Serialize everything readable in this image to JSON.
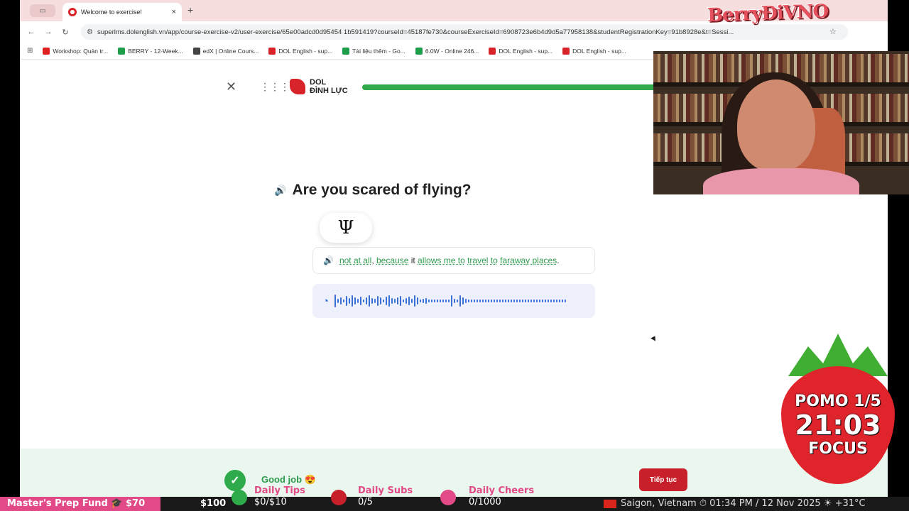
{
  "browser": {
    "tab_title": "Welcome to exercise!",
    "tab_close": "×",
    "new_tab": "+",
    "url": "superlms.dolenglish.vn/app/course-exercise-v2/user-exercise/65e00adcd0d95454 1b591419?courseId=45187fe730&courseExerciseId=6908723e6b4d9d5a77958138&studentRegistrationKey=91b8928e&t=Sessi...",
    "bookmarks": [
      {
        "label": "Workshop: Quản tr...",
        "color": "#e02020"
      },
      {
        "label": "BERRY - 12-Week...",
        "color": "#1e9e4a"
      },
      {
        "label": "edX | Online Cours...",
        "color": "#444444"
      },
      {
        "label": "DOL English - sup...",
        "color": "#d8232a"
      },
      {
        "label": "Tài liệu thêm - Go...",
        "color": "#1e9e4a"
      },
      {
        "label": "6.0W - Online 246...",
        "color": "#1e9e4a"
      },
      {
        "label": "DOL English - sup...",
        "color": "#d8232a"
      },
      {
        "label": "DOL English - sup...",
        "color": "#d8232a"
      }
    ],
    "brand_overlay": "BerryĐiVNO"
  },
  "page": {
    "logo_text_1": "DOL",
    "logo_text_2": "ĐÌNH LỰC",
    "progress_fraction": 1.0,
    "question": "Are you scared of flying?",
    "bubble_glyph": "Ψ",
    "answer_parts": [
      {
        "text": "not at all",
        "style": "w"
      },
      {
        "text": ", ",
        "style": "n"
      },
      {
        "text": "because",
        "style": "w"
      },
      {
        "text": " it ",
        "style": "n"
      },
      {
        "text": "allows me to",
        "style": "w"
      },
      {
        "text": " ",
        "style": "n"
      },
      {
        "text": "travel",
        "style": "w"
      },
      {
        "text": " ",
        "style": "n"
      },
      {
        "text": "to",
        "style": "w"
      },
      {
        "text": " ",
        "style": "n"
      },
      {
        "text": "faraway places",
        "style": "w"
      },
      {
        "text": ".",
        "style": "n"
      }
    ],
    "footer_status": "Good job 😍",
    "next_button": "Tiếp tục"
  },
  "overlay": {
    "pomo": "POMO 1/5",
    "timer": "21:03",
    "focus": "FOCUS",
    "fund": "Master's Prep Fund 🎓 $70",
    "fund_total": "$100",
    "daily_tips_label": "Daily Tips",
    "daily_tips_value": "$0/$10",
    "daily_subs_label": "Daily Subs",
    "daily_subs_value": "0/5",
    "daily_cheers_label": "Daily Cheers",
    "daily_cheers_value": "0/1000",
    "location": "Saigon, Vietnam ⏱ 01:34 PM / 12 Nov 2025 ☀ +31°C"
  },
  "colors": {
    "accent_red": "#d8232a",
    "success_green": "#2eaa4a",
    "pink": "#e14a86"
  }
}
